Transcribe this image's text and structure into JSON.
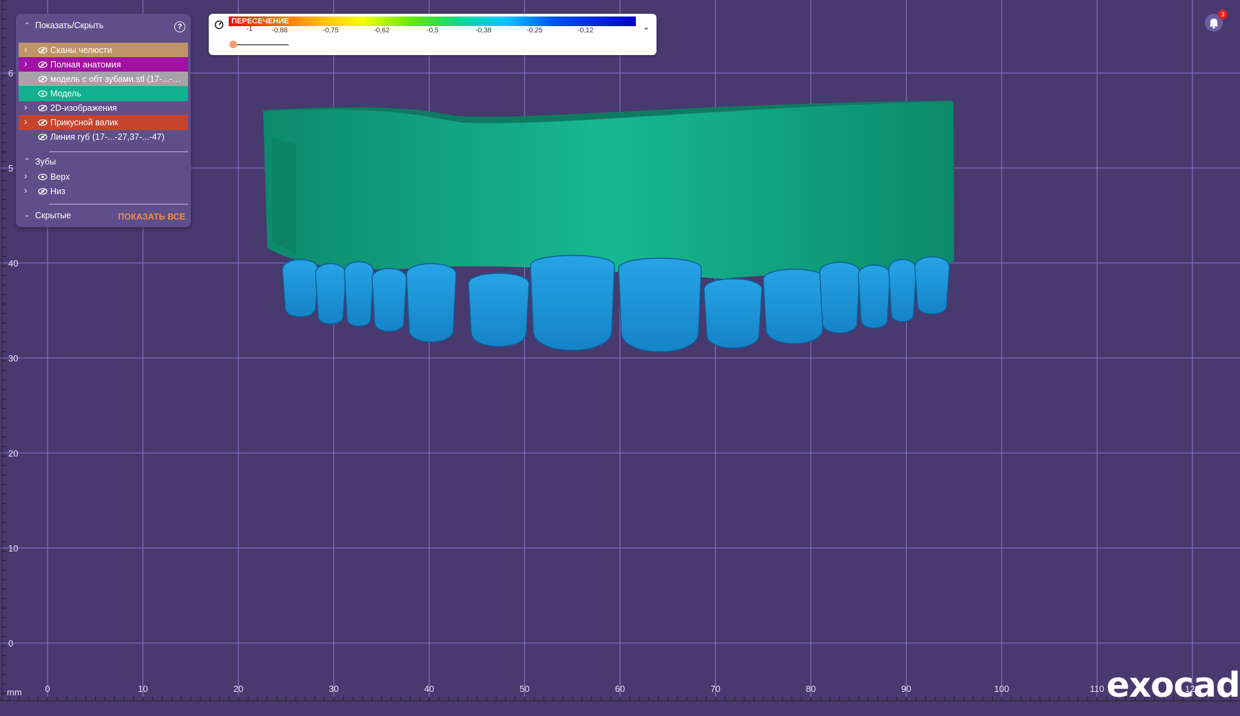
{
  "panel": {
    "title": "Показать/Скрыть",
    "help": "?",
    "rows": [
      {
        "label": "Сканы челюсти",
        "color": "#bf9466"
      },
      {
        "label": "Полная анатомия",
        "color": "#a112a2"
      },
      {
        "label": "модель с обт зубами.stl (17-...-27,3...",
        "color": "#a6a3a8"
      },
      {
        "label": "Модель",
        "color": "#12b08e"
      },
      {
        "label": "2D-изображения",
        "color": ""
      },
      {
        "label": "Прикусной валик",
        "color": "#c8432c"
      },
      {
        "label": "Линия губ (17-...-27,37-...-47)",
        "color": ""
      }
    ],
    "teeth_group": "Зубы",
    "teeth": [
      {
        "label": "Верх"
      },
      {
        "label": "Низ"
      }
    ],
    "hidden_group": "Скрытые",
    "show_all": "ПОКАЗАТЬ ВСЕ"
  },
  "colorbar": {
    "title": "ПЕРЕСЕЧЕНИЕ",
    "ticks": [
      "-1",
      "-0,88",
      "-0,75",
      "-0,62",
      "-0,5",
      "-0,38",
      "-0,25",
      "-0,12"
    ]
  },
  "notifications": {
    "count": "3"
  },
  "ruler": {
    "unit": "mm",
    "x_labels": [
      "0",
      "10",
      "20",
      "30",
      "40",
      "50",
      "60",
      "70",
      "80",
      "90",
      "100",
      "110",
      "120"
    ],
    "y_labels": [
      "6",
      "5",
      "40",
      "30",
      "20",
      "10",
      "0"
    ]
  },
  "logo": "exocad",
  "colors": {
    "viewport_bg": "#48396e",
    "grid": "#7d6fbf",
    "model": "#14a784",
    "teeth": "#1e94d6"
  },
  "icons": {
    "eye": "eye-icon",
    "eye_hidden": "eye-slash-icon",
    "bell": "bell-icon"
  }
}
